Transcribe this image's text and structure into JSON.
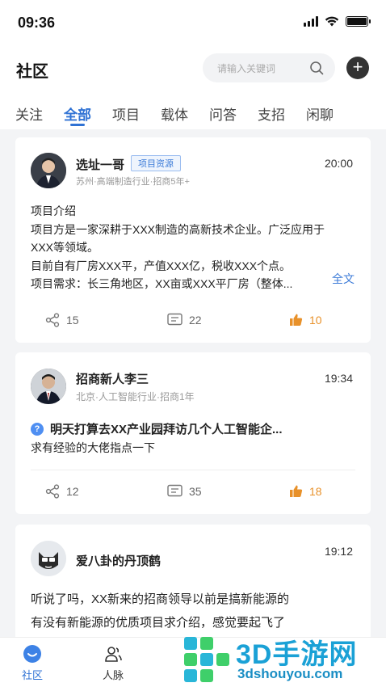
{
  "status": {
    "time": "09:36"
  },
  "header": {
    "title": "社区",
    "search_placeholder": "请输入关键词"
  },
  "tabs": [
    {
      "label": "关注",
      "active": false
    },
    {
      "label": "全部",
      "active": true
    },
    {
      "label": "项目",
      "active": false
    },
    {
      "label": "载体",
      "active": false
    },
    {
      "label": "问答",
      "active": false
    },
    {
      "label": "支招",
      "active": false
    },
    {
      "label": "闲聊",
      "active": false
    }
  ],
  "posts": [
    {
      "author": "选址一哥",
      "tag": "项目资源",
      "meta": "苏州·高端制造行业·招商5年+",
      "time": "20:00",
      "lines": [
        "项目介绍",
        "项目方是一家深耕于XXX制造的高新技术企业。广泛应用于",
        "XXX等领域。",
        "目前自有厂房XXX平，产值XXX亿，税收XXX个点。",
        "项目需求：长三角地区，XX亩或XXX平厂房（整体..."
      ],
      "more": "全文",
      "shares": "15",
      "comments": "22",
      "likes": "10"
    },
    {
      "author": "招商新人李三",
      "meta": "北京·人工智能行业·招商1年",
      "time": "19:34",
      "question_badge": "?",
      "question": "明天打算去XX产业园拜访几个人工智能企...",
      "text": "求有经验的大佬指点一下",
      "shares": "12",
      "comments": "35",
      "likes": "18"
    },
    {
      "author": "爱八卦的丹顶鹤",
      "time": "19:12",
      "lines": [
        "听说了吗，XX新来的招商领导以前是搞新能源的",
        "有没有新能源的优质项目求介绍，感觉要起飞了"
      ]
    }
  ],
  "bottom_nav": [
    {
      "label": "社区",
      "active": true
    },
    {
      "label": "人脉",
      "active": false
    }
  ],
  "watermark": {
    "title": "3D手游网",
    "url": "3dshouyou.com"
  },
  "colors": {
    "accent": "#2f72d4",
    "like": "#e8912a",
    "tag": "#3c7bd8"
  }
}
